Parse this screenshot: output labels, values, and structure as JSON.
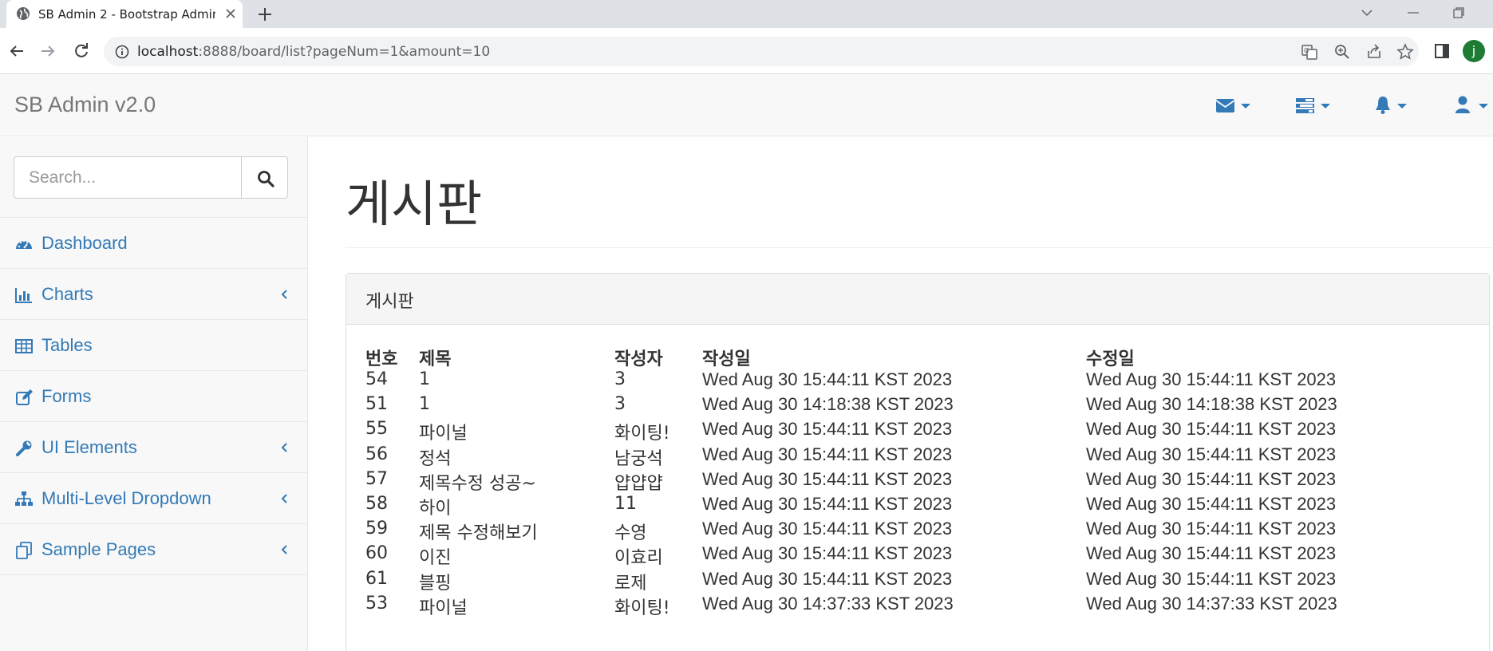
{
  "browser": {
    "tab_title": "SB Admin 2 - Bootstrap Admin Theme",
    "url_host": "localhost",
    "url_rest": ":8888/board/list?pageNum=1&amount=10",
    "profile_initial": "j"
  },
  "navbar": {
    "brand": "SB Admin v2.0",
    "accent": "#337ab7"
  },
  "sidebar": {
    "search_placeholder": "Search...",
    "items": [
      {
        "label": "Dashboard",
        "icon": "dashboard-icon",
        "has_submenu": false
      },
      {
        "label": "Charts",
        "icon": "bar-chart-icon",
        "has_submenu": true
      },
      {
        "label": "Tables",
        "icon": "table-icon",
        "has_submenu": false
      },
      {
        "label": "Forms",
        "icon": "edit-icon",
        "has_submenu": false
      },
      {
        "label": "UI Elements",
        "icon": "wrench-icon",
        "has_submenu": true
      },
      {
        "label": "Multi-Level Dropdown",
        "icon": "sitemap-icon",
        "has_submenu": true
      },
      {
        "label": "Sample Pages",
        "icon": "files-icon",
        "has_submenu": true
      }
    ]
  },
  "main": {
    "page_title": "게시판",
    "panel_title": "게시판",
    "table": {
      "headers": [
        "번호",
        "제목",
        "작성자",
        "작성일",
        "수정일"
      ],
      "rows": [
        [
          "54",
          "1",
          "3",
          "Wed Aug 30 15:44:11 KST 2023",
          "Wed Aug 30 15:44:11 KST 2023"
        ],
        [
          "51",
          "1",
          "3",
          "Wed Aug 30 14:18:38 KST 2023",
          "Wed Aug 30 14:18:38 KST 2023"
        ],
        [
          "55",
          "파이널",
          "화이팅!",
          "Wed Aug 30 15:44:11 KST 2023",
          "Wed Aug 30 15:44:11 KST 2023"
        ],
        [
          "56",
          "정석",
          "남궁석",
          "Wed Aug 30 15:44:11 KST 2023",
          "Wed Aug 30 15:44:11 KST 2023"
        ],
        [
          "57",
          "제목수정 성공~",
          "얍얍얍",
          "Wed Aug 30 15:44:11 KST 2023",
          "Wed Aug 30 15:44:11 KST 2023"
        ],
        [
          "58",
          "하이",
          "11",
          "Wed Aug 30 15:44:11 KST 2023",
          "Wed Aug 30 15:44:11 KST 2023"
        ],
        [
          "59",
          "제목 수정해보기",
          "수영",
          "Wed Aug 30 15:44:11 KST 2023",
          "Wed Aug 30 15:44:11 KST 2023"
        ],
        [
          "60",
          "이진",
          "이효리",
          "Wed Aug 30 15:44:11 KST 2023",
          "Wed Aug 30 15:44:11 KST 2023"
        ],
        [
          "61",
          "블핑",
          "로제",
          "Wed Aug 30 15:44:11 KST 2023",
          "Wed Aug 30 15:44:11 KST 2023"
        ],
        [
          "53",
          "파이널",
          "화이팅!",
          "Wed Aug 30 14:37:33 KST 2023",
          "Wed Aug 30 14:37:33 KST 2023"
        ]
      ]
    }
  }
}
